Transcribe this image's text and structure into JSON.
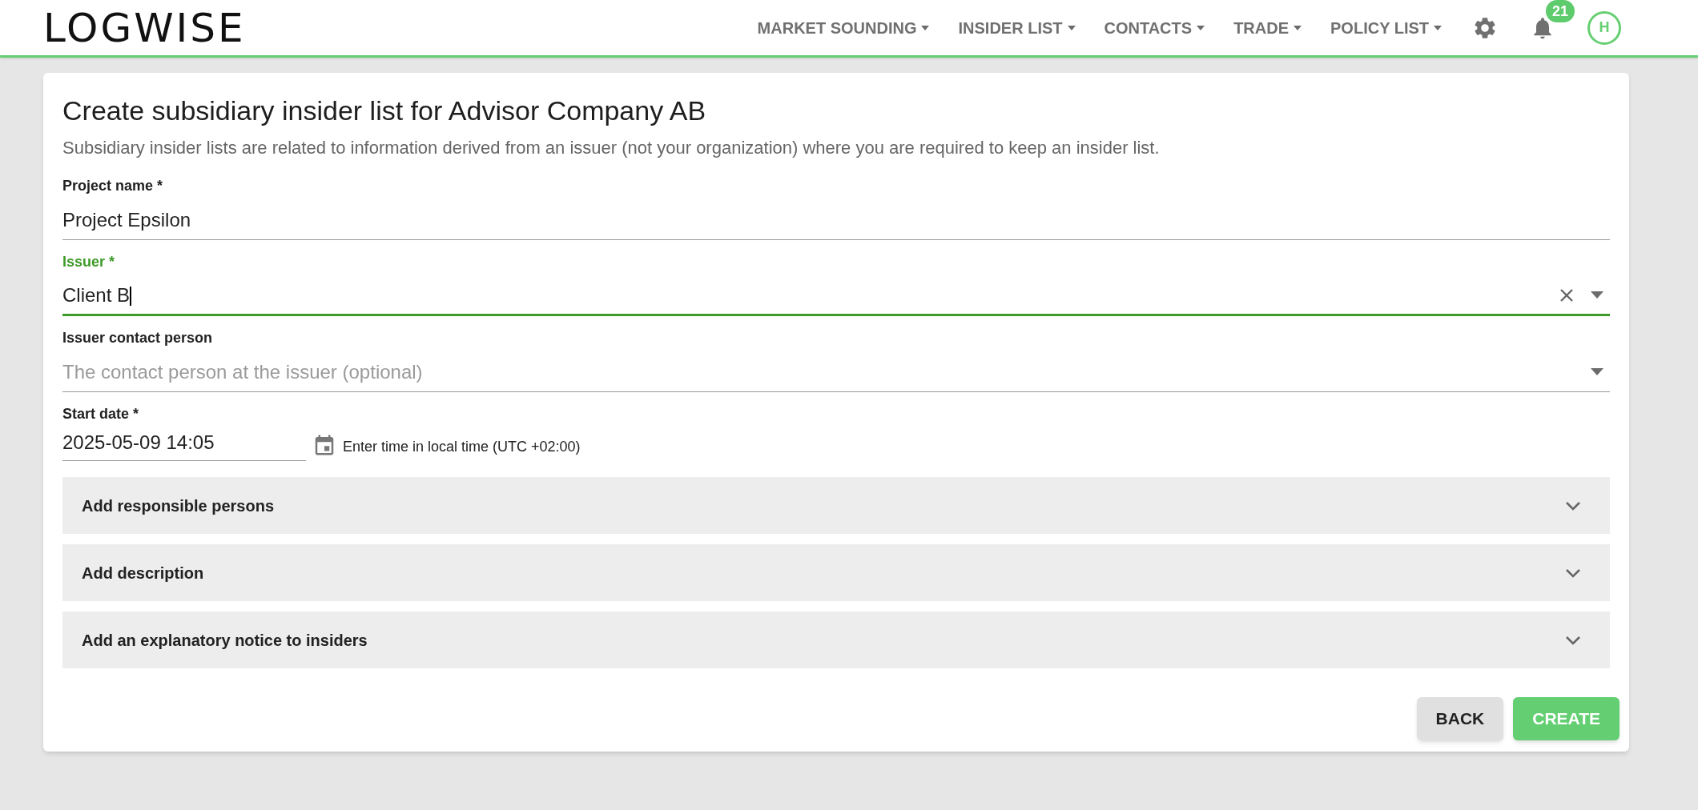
{
  "header": {
    "logo": "LOGWISE",
    "nav": [
      {
        "label": "MARKET SOUNDING"
      },
      {
        "label": "INSIDER LIST"
      },
      {
        "label": "CONTACTS"
      },
      {
        "label": "TRADE"
      },
      {
        "label": "POLICY LIST"
      }
    ],
    "notifications": "21",
    "avatar": "H"
  },
  "form": {
    "title": "Create subsidiary insider list for Advisor Company AB",
    "subtitle": "Subsidiary insider lists are related to information derived from an issuer (not your organization) where you are required to keep an insider list.",
    "fields": [
      {
        "kind": "text",
        "label": "Project name *",
        "value": "Project Epsilon",
        "focused": false
      },
      {
        "kind": "select",
        "label": "Issuer *",
        "value": "Client B",
        "focused": true,
        "clearable": true
      },
      {
        "kind": "select",
        "label": "Issuer contact person",
        "placeholder": "The contact person at the issuer (optional)",
        "focused": false,
        "clearable": false
      },
      {
        "kind": "date",
        "label": "Start date *",
        "value": "2025-05-09 14:05",
        "hint": "Enter time in local time (UTC +02:00)"
      }
    ],
    "sections": [
      {
        "label": "Add responsible persons",
        "expanded": false
      },
      {
        "label": "Add description",
        "expanded": false
      },
      {
        "label": "Add an explanatory notice to insiders",
        "expanded": false
      }
    ],
    "buttons": [
      {
        "kind": "secondary",
        "label": "BACK"
      },
      {
        "kind": "primary",
        "label": "CREATE"
      }
    ]
  }
}
